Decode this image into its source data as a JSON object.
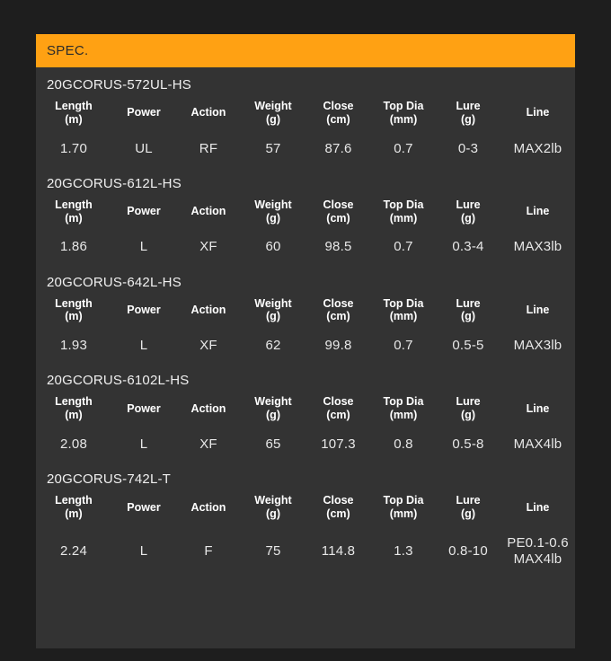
{
  "header": {
    "title": "SPEC."
  },
  "columns": [
    {
      "label": "Length",
      "unit": "(m)"
    },
    {
      "label": "Power",
      "unit": ""
    },
    {
      "label": "Action",
      "unit": ""
    },
    {
      "label": "Weight",
      "unit": "(g)"
    },
    {
      "label": "Close",
      "unit": "(cm)"
    },
    {
      "label": "Top Dia",
      "unit": "(mm)"
    },
    {
      "label": "Lure",
      "unit": "(g)"
    },
    {
      "label": "Line",
      "unit": ""
    }
  ],
  "colors": {
    "accent": "#ffa113",
    "panel": "#333333",
    "page_background": "#1e1e1e",
    "header_text": "#2b2b2b",
    "body_text": "#e8e8e8"
  },
  "models": [
    {
      "name": "20GCORUS-572UL-HS",
      "length": "1.70",
      "power": "UL",
      "action": "RF",
      "weight": "57",
      "close": "87.6",
      "top_dia": "0.7",
      "lure": "0-3",
      "line": "MAX2lb",
      "line2": ""
    },
    {
      "name": "20GCORUS-612L-HS",
      "length": "1.86",
      "power": "L",
      "action": "XF",
      "weight": "60",
      "close": "98.5",
      "top_dia": "0.7",
      "lure": "0.3-4",
      "line": "MAX3lb",
      "line2": ""
    },
    {
      "name": "20GCORUS-642L-HS",
      "length": "1.93",
      "power": "L",
      "action": "XF",
      "weight": "62",
      "close": "99.8",
      "top_dia": "0.7",
      "lure": "0.5-5",
      "line": "MAX3lb",
      "line2": ""
    },
    {
      "name": "20GCORUS-6102L-HS",
      "length": "2.08",
      "power": "L",
      "action": "XF",
      "weight": "65",
      "close": "107.3",
      "top_dia": "0.8",
      "lure": "0.5-8",
      "line": "MAX4lb",
      "line2": ""
    },
    {
      "name": "20GCORUS-742L-T",
      "length": "2.24",
      "power": "L",
      "action": "F",
      "weight": "75",
      "close": "114.8",
      "top_dia": "1.3",
      "lure": "0.8-10",
      "line": "PE0.1-0.6",
      "line2": "MAX4lb"
    }
  ]
}
